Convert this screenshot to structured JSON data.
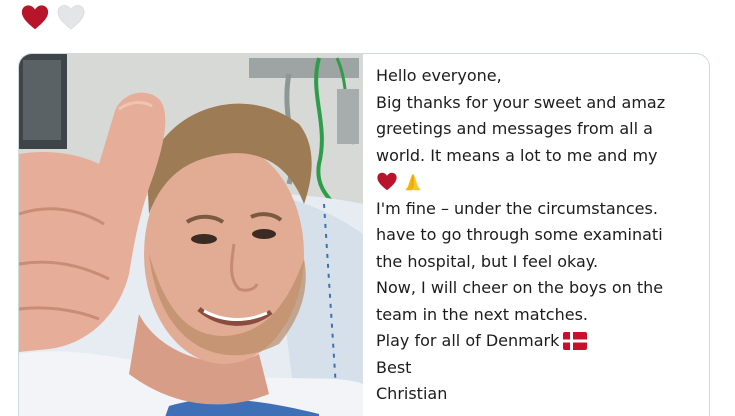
{
  "header": {
    "hearts": [
      "red-heart",
      "white-heart"
    ]
  },
  "post": {
    "lines": [
      "Hello everyone,",
      "Big thanks for your sweet and amaz",
      "greetings and messages from all a",
      "world. It means a lot to me and my",
      "",
      "I'm fine – under the circumstances.",
      "have to go through some examinati",
      "the hospital, but I feel okay.",
      "Now, I will cheer on the boys on the",
      "team in the next matches.",
      "Play for all of Denmark",
      "Best",
      "Christian"
    ],
    "emojis": {
      "line_4": [
        "red-heart",
        "folded-hands"
      ],
      "line_10": [
        "denmark-flag"
      ]
    }
  },
  "colors": {
    "heart_red": "#b8142b",
    "heart_white": "#e3e5e6",
    "card_border": "#cfd9de",
    "text": "#1c1c1c",
    "flag_red": "#c8102e"
  }
}
